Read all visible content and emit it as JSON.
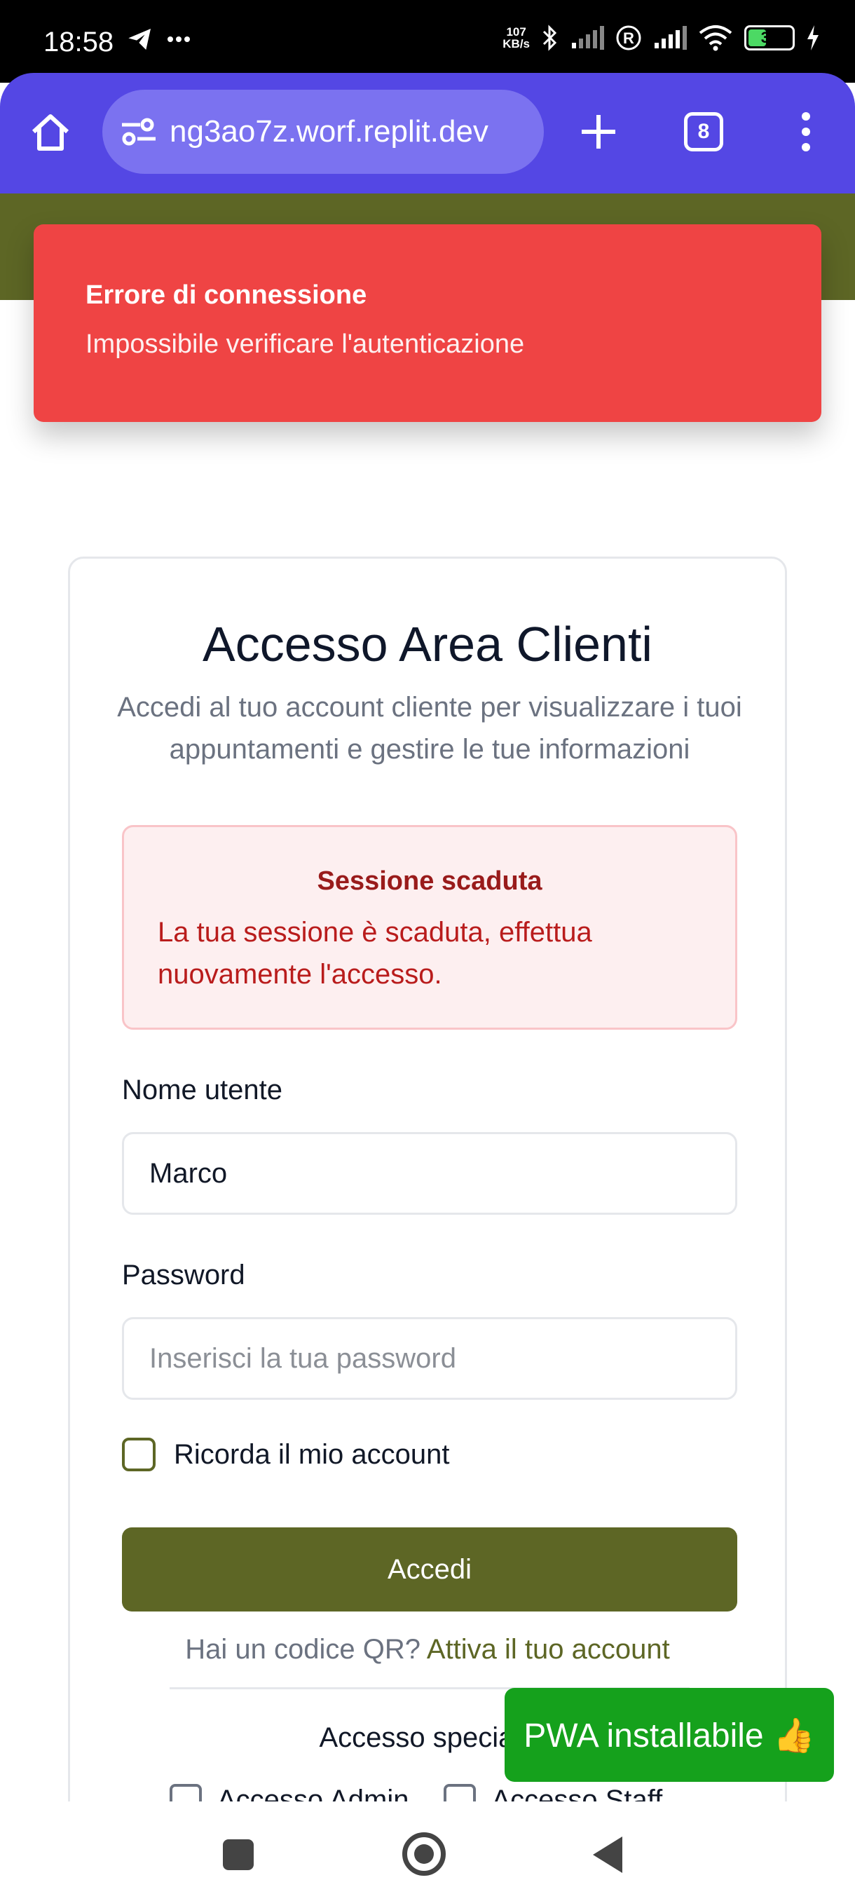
{
  "status_bar": {
    "time": "18:58",
    "speed_value": "107",
    "speed_unit": "KB/s",
    "battery": "39"
  },
  "browser": {
    "url": "ng3ao7z.worf.replit.dev",
    "tab_count": "8"
  },
  "toast": {
    "title": "Errore di connessione",
    "message": "Impossibile verificare l'autenticazione"
  },
  "card": {
    "title": "Accesso Area Clienti",
    "description": "Accedi al tuo account cliente per visualizzare i tuoi appuntamenti e gestire le tue informazioni"
  },
  "alert": {
    "title": "Sessione scaduta",
    "message": "La tua sessione è scaduta, effettua nuovamente l'accesso."
  },
  "form": {
    "username_label": "Nome utente",
    "username_value": "Marco",
    "password_label": "Password",
    "password_placeholder": "Inserisci la tua password",
    "remember_label": "Ricorda il mio account",
    "submit_label": "Accedi"
  },
  "qr": {
    "prompt": "Hai un codice QR? ",
    "link": "Attiva il tuo account"
  },
  "special": {
    "title": "Accesso speciale",
    "admin_label": "Accesso Admin",
    "staff_label": "Accesso Staff"
  },
  "pwa_badge": "PWA installabile 👍",
  "colors": {
    "browser_accent": "#5447e4",
    "brand_olive": "#5d6625",
    "toast_red": "#ef4444",
    "pwa_green": "#15a11c"
  }
}
